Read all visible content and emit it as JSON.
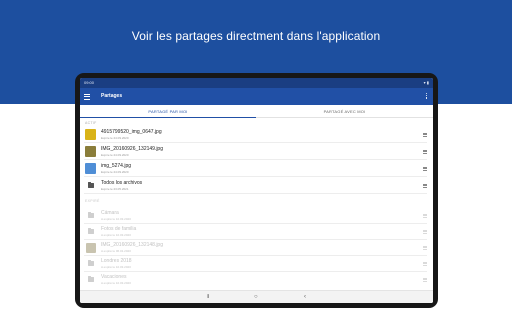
{
  "headline": "Voir les partages directment dans l'application",
  "statusbar": {
    "time": "09:00",
    "icons": "▾ ▮"
  },
  "appbar": {
    "title": "Partages",
    "menu_icon": "hamburger-menu-icon",
    "overflow_icon": "more-vertical-icon"
  },
  "tabs": [
    {
      "label": "Partagé par moi",
      "active": true
    },
    {
      "label": "Partagé avec moi",
      "active": false
    }
  ],
  "sections": {
    "active": "Actif",
    "expired": "Expiré"
  },
  "active_items": [
    {
      "title": "4915799520_img_0647.jpg",
      "subtitle": "Expire le 24.09.2020",
      "kind": "image",
      "thumb_color": "#d9b318"
    },
    {
      "title": "IMG_20160926_132149.jpg",
      "subtitle": "Expire le 24.09.2020",
      "kind": "image",
      "thumb_color": "#8a7d3a"
    },
    {
      "title": "img_5274.jpg",
      "subtitle": "Expire le 24.09.2020",
      "kind": "image",
      "thumb_color": "#4f8ed6"
    },
    {
      "title": "Todos los archivos",
      "subtitle": "Expire le 23.05.2021",
      "kind": "folder"
    }
  ],
  "expired_items": [
    {
      "title": "Cámara",
      "subtitle": "A expiré le 10.03.2020",
      "kind": "folder"
    },
    {
      "title": "Fotos de familia",
      "subtitle": "A expiré le 10.03.2020",
      "kind": "folder"
    },
    {
      "title": "IMG_20160926_132148.jpg",
      "subtitle": "A expiré le 06.01.2020",
      "kind": "image",
      "thumb_color": "#c9c4b0"
    },
    {
      "title": "Londres 2018",
      "subtitle": "A expiré le 10.03.2020",
      "kind": "folder"
    },
    {
      "title": "Vacaciones",
      "subtitle": "A expiré le 10.03.2020",
      "kind": "folder"
    }
  ],
  "navbar": {
    "recents": "⦀",
    "home": "○",
    "back": "‹"
  }
}
